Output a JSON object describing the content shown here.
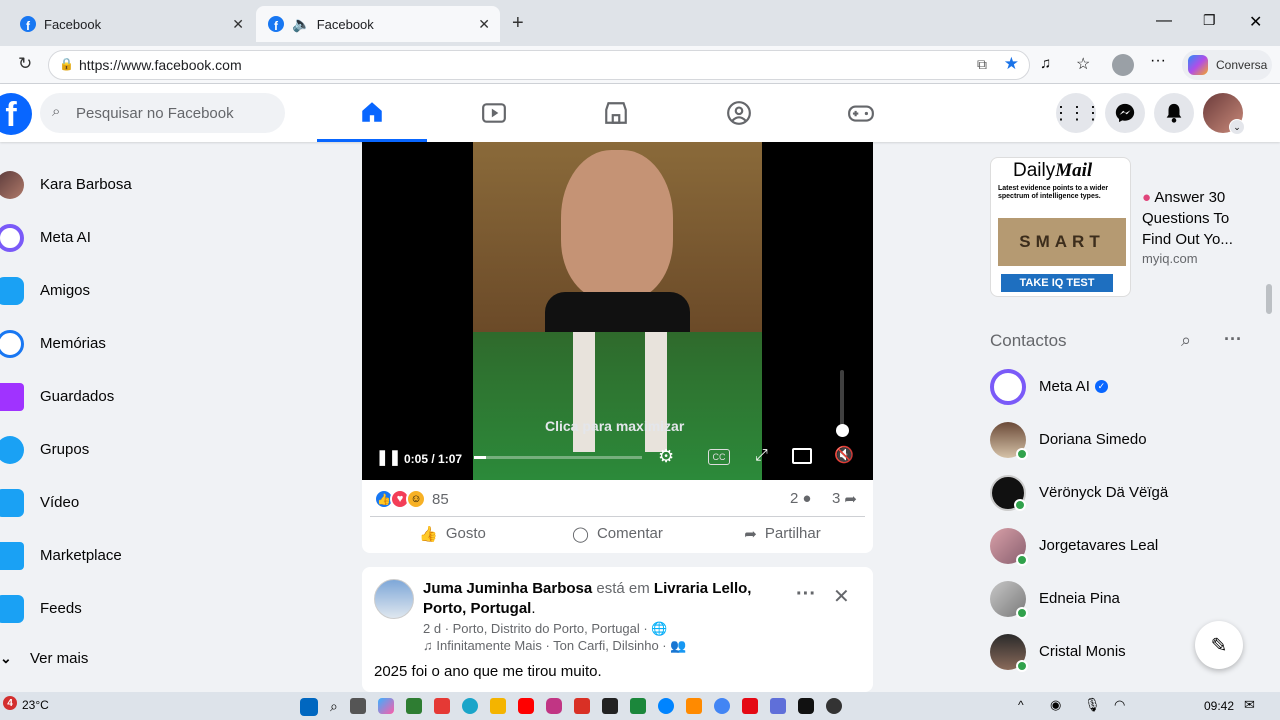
{
  "browser": {
    "tabs": [
      {
        "title": "Facebook"
      },
      {
        "title": "Facebook"
      }
    ],
    "url": "https://www.facebook.com",
    "copilot_label": "Conversa"
  },
  "fb_header": {
    "search_placeholder": "Pesquisar no Facebook"
  },
  "left_sidebar": {
    "items": [
      {
        "label": "Kara Barbosa",
        "icon": "avatar"
      },
      {
        "label": "Meta AI",
        "icon": "meta-ai-icon"
      },
      {
        "label": "Amigos",
        "icon": "friends-icon"
      },
      {
        "label": "Memórias",
        "icon": "memories-icon"
      },
      {
        "label": "Guardados",
        "icon": "saved-icon"
      },
      {
        "label": "Grupos",
        "icon": "groups-icon"
      },
      {
        "label": "Vídeo",
        "icon": "video-icon"
      },
      {
        "label": "Marketplace",
        "icon": "marketplace-icon"
      },
      {
        "label": "Feeds",
        "icon": "feeds-icon"
      }
    ],
    "see_more": "Ver mais"
  },
  "video_post": {
    "overlay_text": "Clica para maximizar",
    "time_current": "0:05",
    "time_total": "1:07",
    "progress": 0.07,
    "reaction_count": "85",
    "comment_count": "2",
    "share_count": "3",
    "actions": {
      "like": "Gosto",
      "comment": "Comentar",
      "share": "Partilhar"
    }
  },
  "post2": {
    "author": "Juma Juminha Barbosa",
    "connector": "está em",
    "place": "Livraria Lello, Porto, Portugal",
    "time": "2 d",
    "location": "Porto, Distrito do Porto, Portugal",
    "music": "Infinitamente Mais · Ton Carfi, Dilsinho",
    "text": "2025 foi o ano que me tirou muito."
  },
  "ad": {
    "brand": "Daily",
    "brand_bold": "Mail",
    "headline_small": "Latest evidence points to a wider spectrum of intelligence types.",
    "blocks": "SMART",
    "cta": "TAKE IQ TEST",
    "title": "Answer 30 Questions To Find Out Yo...",
    "domain": "myiq.com"
  },
  "contacts": {
    "heading": "Contactos",
    "list": [
      {
        "name": "Meta AI",
        "verified": true,
        "online": false
      },
      {
        "name": "Doriana Simedo",
        "online": true
      },
      {
        "name": "Vërönyck Dä Vëïgä",
        "online": true
      },
      {
        "name": "Jorgetavares Leal",
        "online": true
      },
      {
        "name": "Edneia Pina",
        "online": true
      },
      {
        "name": "Cristal Monis",
        "online": true
      }
    ]
  },
  "taskbar": {
    "weather": "23°C",
    "badge": "4",
    "time": "09:42"
  },
  "colors": {
    "fb_blue": "#0866ff",
    "online": "#31a24c",
    "cta": "#1e6fc0"
  }
}
